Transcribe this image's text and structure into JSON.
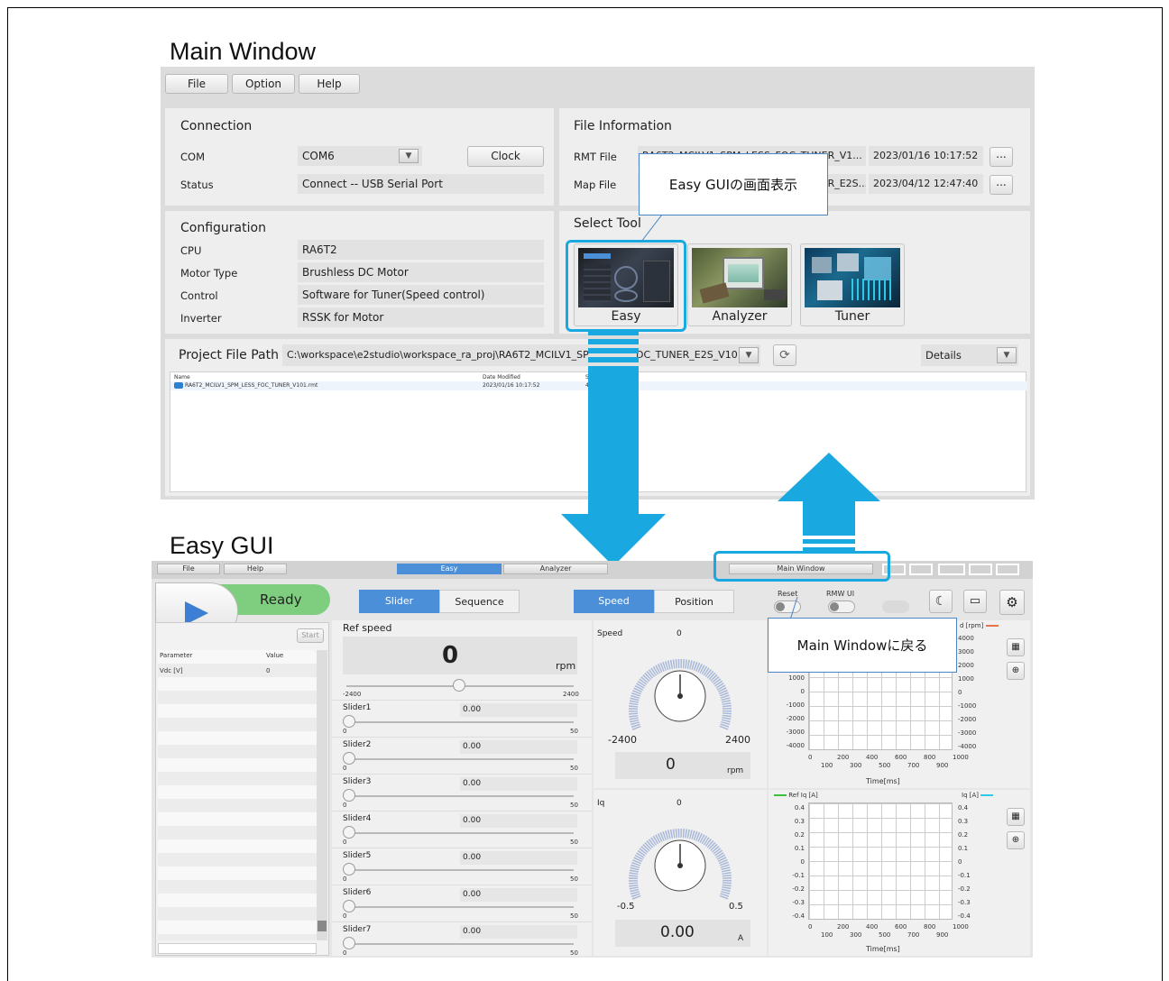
{
  "main_window": {
    "title": "Main Window",
    "menu": [
      "File",
      "Option",
      "Help"
    ],
    "connection": {
      "title": "Connection",
      "com_label": "COM",
      "com_value": "COM6",
      "clock_button": "Clock",
      "status_label": "Status",
      "status_value": "Connect -- USB Serial Port"
    },
    "file_info": {
      "title": "File Information",
      "rmt_label": "RMT File",
      "rmt_value": "RA6T2_MCILV1_SPM_LESS_FOC_TUNER_V1...",
      "rmt_date": "2023/01/16 10:17:52",
      "map_label": "Map File",
      "map_value": "RA6T2_MCILV1_SPM_LESS_FOC_TUNER_E2S...",
      "map_date": "2023/04/12 12:47:40",
      "browse": "..."
    },
    "configuration": {
      "title": "Configuration",
      "rows": [
        {
          "label": "CPU",
          "value": "RA6T2"
        },
        {
          "label": "Motor Type",
          "value": "Brushless DC Motor"
        },
        {
          "label": "Control",
          "value": "Software for Tuner(Speed control)"
        },
        {
          "label": "Inverter",
          "value": "RSSK for Motor"
        }
      ]
    },
    "select_tool": {
      "title": "Select Tool",
      "tools": [
        "Easy",
        "Analyzer",
        "Tuner"
      ]
    },
    "project": {
      "label": "Project File Path",
      "path": "C:\\workspace\\e2studio\\workspace_ra_proj\\RA6T2_MCILV1_SP",
      "path_tail": "DC_TUNER_E2S_V101",
      "details": "Details",
      "columns": [
        "Name",
        "Date Modified",
        "Si"
      ],
      "file_name": "RA6T2_MCILV1_SPM_LESS_FOC_TUNER_V101.rmt",
      "file_date": "2023/01/16 10:17:52",
      "file_size": "479"
    }
  },
  "callouts": {
    "easy": "Easy GUIの画面表示",
    "back": "Main Windowに戻る"
  },
  "easy_gui": {
    "title": "Easy GUI",
    "menu": [
      "File",
      "Help"
    ],
    "tabs": [
      "Easy",
      "Analyzer"
    ],
    "main_window_button": "Main Window",
    "status": "Ready",
    "mode": [
      "Slider",
      "Sequence"
    ],
    "control": [
      "Speed",
      "Position"
    ],
    "reset_label": "Reset",
    "rmw_label": "RMW UI",
    "start": "Start",
    "param_header": [
      "Parameter",
      "Value"
    ],
    "param_row": [
      "Vdc [V]",
      "0"
    ],
    "ref_speed": {
      "label": "Ref speed",
      "value": "0",
      "unit": "rpm",
      "min": "-2400",
      "max": "2400"
    },
    "sliders": [
      {
        "name": "Slider1",
        "value": "0.00",
        "min": "0",
        "max": "50"
      },
      {
        "name": "Slider2",
        "value": "0.00",
        "min": "0",
        "max": "50"
      },
      {
        "name": "Slider3",
        "value": "0.00",
        "min": "0",
        "max": "50"
      },
      {
        "name": "Slider4",
        "value": "0.00",
        "min": "0",
        "max": "50"
      },
      {
        "name": "Slider5",
        "value": "0.00",
        "min": "0",
        "max": "50"
      },
      {
        "name": "Slider6",
        "value": "0.00",
        "min": "0",
        "max": "50"
      },
      {
        "name": "Slider7",
        "value": "0.00",
        "min": "0",
        "max": "50"
      }
    ],
    "gauge_speed": {
      "label": "Speed",
      "top": "0",
      "min": "-2400",
      "max": "2400",
      "value": "0",
      "unit": "rpm"
    },
    "gauge_iq": {
      "label": "Iq",
      "top": "0",
      "min": "-0.5",
      "max": "0.5",
      "value": "0.00",
      "unit": "A"
    },
    "chart_speed": {
      "legend_right": "d [rpm]",
      "left_ticks": [
        "1000",
        "0",
        "-1000",
        "-2000",
        "-3000",
        "-4000"
      ],
      "right_ticks": [
        "4000",
        "3000",
        "2000",
        "1000",
        "0",
        "-1000",
        "-2000",
        "-3000",
        "-4000"
      ],
      "x_top": [
        "0",
        "200",
        "400",
        "600",
        "800",
        "1000"
      ],
      "x_bottom": [
        "100",
        "300",
        "500",
        "700",
        "900"
      ],
      "xlabel": "Time[ms]"
    },
    "chart_iq": {
      "legend_left": "Ref Iq [A]",
      "legend_right": "Iq [A]",
      "ticks": [
        "0.4",
        "0.3",
        "0.2",
        "0.1",
        "0",
        "-0.1",
        "-0.2",
        "-0.3",
        "-0.4"
      ],
      "x_top": [
        "0",
        "200",
        "400",
        "600",
        "800",
        "1000"
      ],
      "x_bottom": [
        "100",
        "300",
        "500",
        "700",
        "900"
      ],
      "xlabel": "Time[ms]"
    },
    "colors": {
      "accent": "#4a8fd8",
      "ready": "#7fce7f",
      "highlight": "#1aa8e0",
      "speed_line": "#e8734a",
      "iq_ref_line": "#3cbf3c",
      "iq_line": "#2ec8e8"
    }
  }
}
